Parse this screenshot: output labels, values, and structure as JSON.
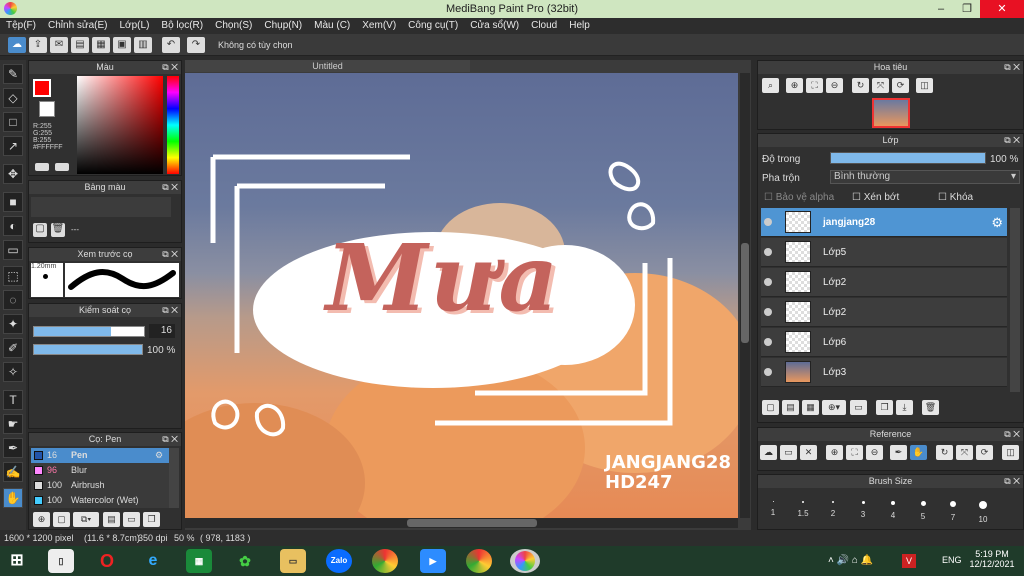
{
  "window": {
    "title": "MediBang Paint Pro (32bit)",
    "minimize": "–",
    "restore": "❐",
    "close": "✕"
  },
  "menu": [
    "Tệp(F)",
    "Chỉnh sửa(E)",
    "Lớp(L)",
    "Bộ lọc(R)",
    "Chọn(S)",
    "Chụp(N)",
    "Màu (C)",
    "Xem(V)",
    "Công cụ(T)",
    "Cửa sổ(W)",
    "Cloud",
    "Help"
  ],
  "toolbar": {
    "option_text": "Không có tùy chọn"
  },
  "color_panel": {
    "title": "Màu",
    "r": "R:255",
    "g": "G:255",
    "b": "B:255",
    "hex": "#FFFFFF"
  },
  "palette_panel": {
    "title": "Bảng màu",
    "dash": "---"
  },
  "brush_preview_panel": {
    "title": "Xem trước cọ",
    "size": "1.20mm"
  },
  "brush_control_panel": {
    "title": "Kiểm soát cọ",
    "size_value": "16",
    "opacity_value": "100 %",
    "size_fraction": 0.7,
    "opacity_fraction": 1.0
  },
  "brush_list": {
    "title": "Cọ: Pen",
    "items": [
      {
        "size": "16",
        "name": "Pen",
        "color": "#2255aa"
      },
      {
        "size": "96",
        "name": "Blur",
        "color": "#ff88ff"
      },
      {
        "size": "100",
        "name": "Airbrush",
        "color": "#dddddd"
      },
      {
        "size": "100",
        "name": "Watercolor (Wet)",
        "color": "#44ccff"
      }
    ]
  },
  "canvas": {
    "tab": "Untitled",
    "art_title": "Mưa",
    "signature1": "JANGJANG28",
    "signature2": "HD247"
  },
  "navigator": {
    "title": "Hoa tiêu"
  },
  "layer_panel": {
    "title": "Lớp",
    "opacity_label": "Độ trong",
    "opacity_value": "100 %",
    "opacity_fraction": 1.0,
    "blend_label": "Pha trộn",
    "blend_value": "Bình thường",
    "protect_alpha": "Bảo vệ alpha",
    "clipping": "Xén bớt",
    "lock": "Khóa",
    "layers": [
      "jangjang28",
      "Lớp5",
      "Lớp2",
      "Lớp2",
      "Lớp6",
      "Lớp3"
    ]
  },
  "reference_panel": {
    "title": "Reference"
  },
  "brush_size_panel": {
    "title": "Brush Size",
    "sizes": [
      "1",
      "1.5",
      "2",
      "3",
      "4",
      "5",
      "7",
      "10"
    ]
  },
  "status": {
    "dimensions": "1600 * 1200 pixel",
    "physical": "(11.6 * 8.7cm)",
    "dpi": "350 dpi",
    "zoom": "50 %",
    "coords": "( 978, 1183 )"
  },
  "taskbar": {
    "time": "5:19 PM",
    "date": "12/12/2021",
    "lang": "ENG"
  },
  "colors": {
    "accent": "#4f95d3",
    "primary_color": "#ff0000",
    "secondary_color": "#ffffff"
  }
}
